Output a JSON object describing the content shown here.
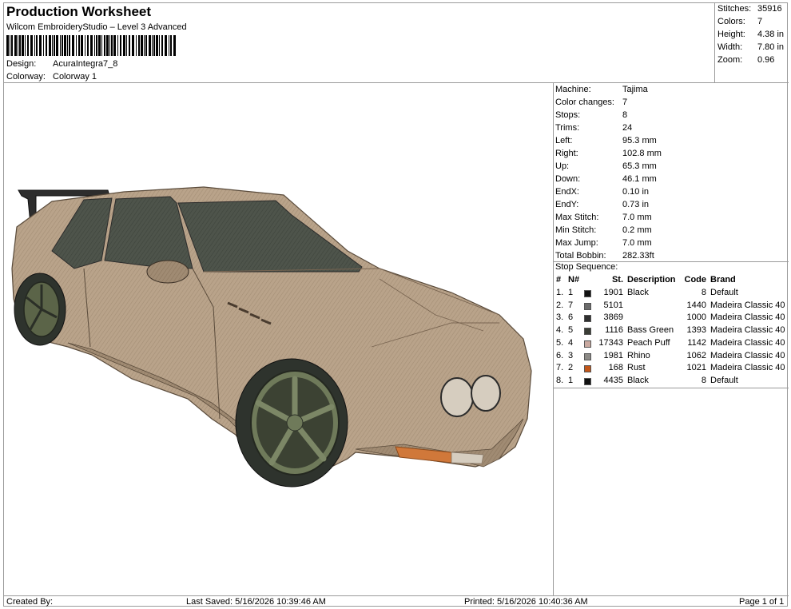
{
  "header": {
    "title": "Production Worksheet",
    "subtitle": "Wilcom EmbroideryStudio – Level 3 Advanced",
    "design_label": "Design:",
    "design_value": "AcuraIntegra7_8",
    "colorway_label": "Colorway:",
    "colorway_value": "Colorway 1"
  },
  "stats": [
    {
      "label": "Stitches:",
      "value": "35916"
    },
    {
      "label": "Colors:",
      "value": "7"
    },
    {
      "label": "Height:",
      "value": "4.38 in"
    },
    {
      "label": "Width:",
      "value": "7.80 in"
    },
    {
      "label": "Zoom:",
      "value": "0.96"
    }
  ],
  "machine_info": [
    {
      "label": "Machine:",
      "value": "Tajima"
    },
    {
      "label": "Color changes:",
      "value": "7"
    },
    {
      "label": "Stops:",
      "value": "8"
    },
    {
      "label": "Trims:",
      "value": "24"
    },
    {
      "label": "Left:",
      "value": "95.3 mm"
    },
    {
      "label": "Right:",
      "value": "102.8 mm"
    },
    {
      "label": "Up:",
      "value": "65.3 mm"
    },
    {
      "label": "Down:",
      "value": "46.1 mm"
    },
    {
      "label": "EndX:",
      "value": "0.10 in"
    },
    {
      "label": "EndY:",
      "value": "0.73 in"
    },
    {
      "label": "Max Stitch:",
      "value": "7.0 mm"
    },
    {
      "label": "Min Stitch:",
      "value": "0.2 mm"
    },
    {
      "label": "Max Jump:",
      "value": "7.0 mm"
    },
    {
      "label": "Total Bobbin:",
      "value": "282.33ft"
    }
  ],
  "stop_sequence": {
    "title": "Stop Sequence:",
    "headers": {
      "num": "#",
      "n": "N#",
      "st": "St.",
      "desc": "Description",
      "code": "Code",
      "brand": "Brand"
    },
    "rows": [
      {
        "num": "1.",
        "n": "1",
        "color": "#111111",
        "st": "1901",
        "desc": "Black",
        "code": "8",
        "brand": "Default"
      },
      {
        "num": "2.",
        "n": "7",
        "color": "#6b6b6b",
        "st": "5101",
        "desc": "",
        "code": "1440",
        "brand": "Madeira Classic 40"
      },
      {
        "num": "3.",
        "n": "6",
        "color": "#2f2f2f",
        "st": "3869",
        "desc": "",
        "code": "1000",
        "brand": "Madeira Classic 40"
      },
      {
        "num": "4.",
        "n": "5",
        "color": "#3a3d35",
        "st": "1116",
        "desc": "Bass Green",
        "code": "1393",
        "brand": "Madeira Classic 40"
      },
      {
        "num": "5.",
        "n": "4",
        "color": "#c9a9a0",
        "st": "17343",
        "desc": "Peach Puff",
        "code": "1142",
        "brand": "Madeira Classic 40"
      },
      {
        "num": "6.",
        "n": "3",
        "color": "#8c8a86",
        "st": "1981",
        "desc": "Rhino",
        "code": "1062",
        "brand": "Madeira Classic 40"
      },
      {
        "num": "7.",
        "n": "2",
        "color": "#c2571a",
        "st": "168",
        "desc": "Rust",
        "code": "1021",
        "brand": "Madeira Classic 40"
      },
      {
        "num": "8.",
        "n": "1",
        "color": "#111111",
        "st": "4435",
        "desc": "Black",
        "code": "8",
        "brand": "Default"
      }
    ]
  },
  "footer": {
    "created_by": "Created By:",
    "last_saved": "Last Saved: 5/16/2026 10:39:46 AM",
    "printed": "Printed: 5/16/2026 10:40:36 AM",
    "page": "Page 1 of 1"
  },
  "colors": {
    "car_body": "#b7a187",
    "car_shadow": "#8e7b65",
    "glass": "#4b5149",
    "wheel": "#2e332d",
    "rim": "#6f7a5a",
    "indicator": "#d0783a"
  }
}
